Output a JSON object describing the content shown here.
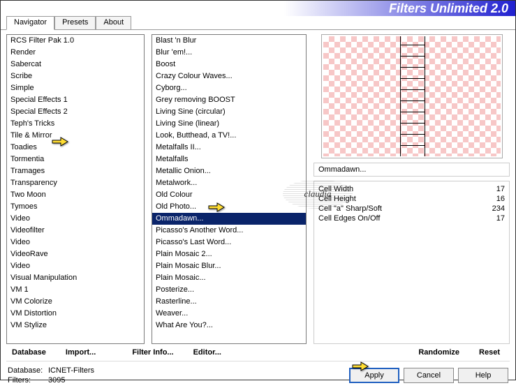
{
  "app_title": "Filters Unlimited 2.0",
  "tabs": [
    "Navigator",
    "Presets",
    "About"
  ],
  "active_tab": 0,
  "categories": [
    "RCS Filter Pak 1.0",
    "Render",
    "Sabercat",
    "Scribe",
    "Simple",
    "Special Effects 1",
    "Special Effects 2",
    "Teph's Tricks",
    "Tile & Mirror",
    "Toadies",
    "Tormentia",
    "Tramages",
    "Transparency",
    "Two Moon",
    "Tymoes",
    "Video",
    "Videofilter",
    "Video",
    "VideoRave",
    "Video",
    "Visual Manipulation",
    "VM 1",
    "VM Colorize",
    "VM Distortion",
    "VM Stylize"
  ],
  "selected_category_index": 9,
  "filters": [
    "Blast 'n Blur",
    "Blur 'em!...",
    "Boost",
    "Crazy Colour Waves...",
    "Cyborg...",
    "Grey removing BOOST",
    "Living Sine (circular)",
    "Living Sine (linear)",
    "Look, Butthead, a TV!...",
    "Metalfalls II...",
    "Metalfalls",
    "Metallic Onion...",
    "Metalwork...",
    "Old Colour",
    "Old Photo...",
    "Ommadawn...",
    "Picasso's Another Word...",
    "Picasso's Last Word...",
    "Plain Mosaic 2...",
    "Plain Mosaic Blur...",
    "Plain Mosaic...",
    "Posterize...",
    "Rasterline...",
    "Weaver...",
    "What Are You?..."
  ],
  "selected_filter_index": 15,
  "current_filter_name": "Ommadawn...",
  "params": [
    {
      "label": "Cell Width",
      "value": 17
    },
    {
      "label": "Cell Height",
      "value": 16
    },
    {
      "label": "Cell \"a\" Sharp/Soft",
      "value": 234
    },
    {
      "label": "Cell Edges On/Off",
      "value": 17
    }
  ],
  "row1_buttons": {
    "database": "Database",
    "import": "Import...",
    "filter_info": "Filter Info...",
    "editor": "Editor...",
    "randomize": "Randomize",
    "reset": "Reset"
  },
  "footer": {
    "db_label": "Database:",
    "db_value": "ICNET-Filters",
    "count_label": "Filters:",
    "count_value": "3095"
  },
  "footer_buttons": {
    "apply": "Apply",
    "cancel": "Cancel",
    "help": "Help"
  },
  "watermark": "claudia"
}
